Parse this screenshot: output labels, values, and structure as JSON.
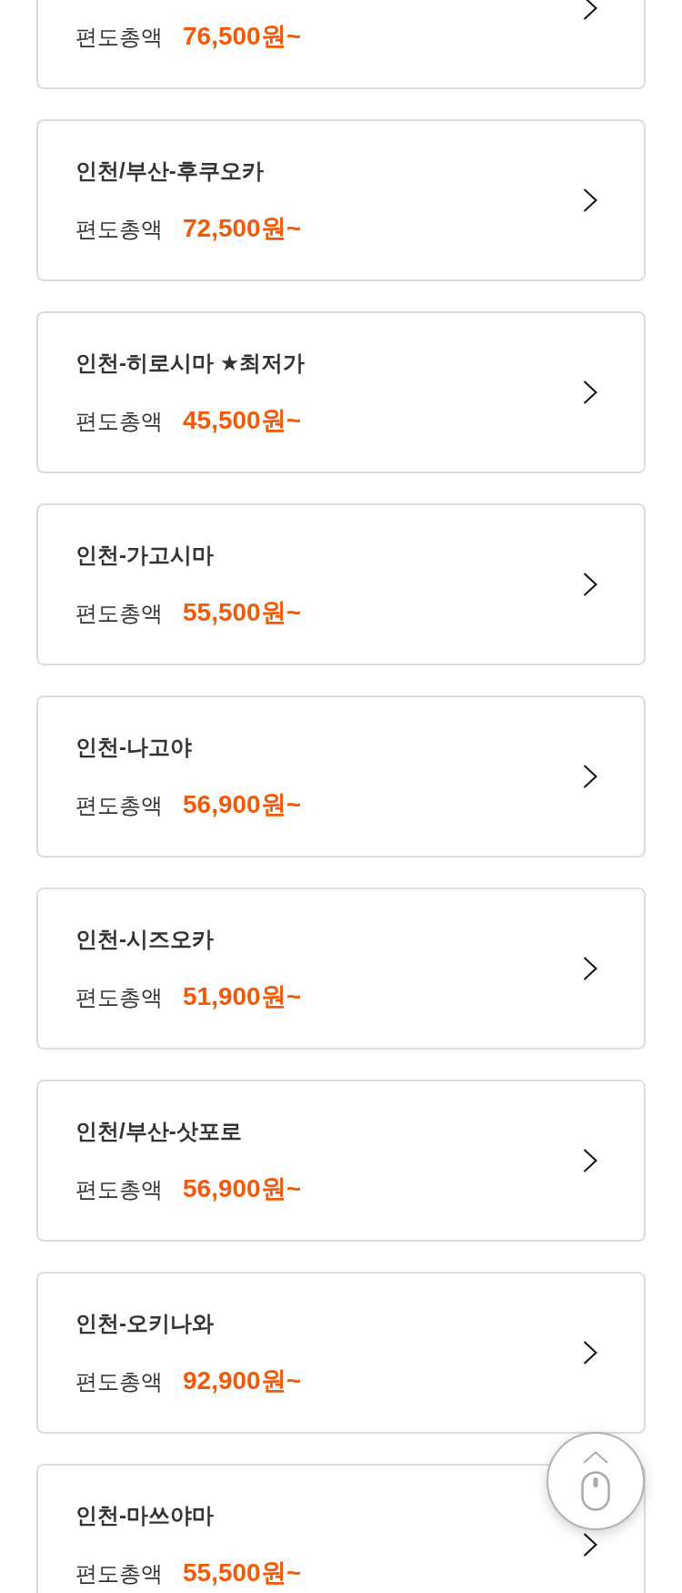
{
  "routes": [
    {
      "price_label": "편도총액",
      "price": "76,500원~"
    },
    {
      "title": "인천/부산-후쿠오카",
      "price_label": "편도총액",
      "price": "72,500원~"
    },
    {
      "title": "인천-히로시마 ★최저가",
      "price_label": "편도총액",
      "price": "45,500원~"
    },
    {
      "title": "인천-가고시마",
      "price_label": "편도총액",
      "price": "55,500원~"
    },
    {
      "title": "인천-나고야",
      "price_label": "편도총액",
      "price": "56,900원~"
    },
    {
      "title": "인천-시즈오카",
      "price_label": "편도총액",
      "price": "51,900원~"
    },
    {
      "title": "인천/부산-삿포로",
      "price_label": "편도총액",
      "price": "56,900원~"
    },
    {
      "title": "인천-오키나와",
      "price_label": "편도총액",
      "price": "92,900원~"
    },
    {
      "title": "인천-마쓰야마",
      "price_label": "편도총액",
      "price": "55,500원~"
    }
  ]
}
